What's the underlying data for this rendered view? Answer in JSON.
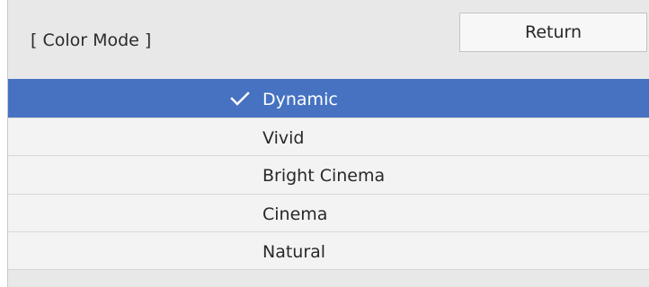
{
  "header": {
    "title": "[ Color Mode ]",
    "return_label": "Return"
  },
  "options": [
    {
      "label": "Dynamic",
      "selected": true
    },
    {
      "label": "Vivid",
      "selected": false
    },
    {
      "label": "Bright Cinema",
      "selected": false
    },
    {
      "label": "Cinema",
      "selected": false
    },
    {
      "label": "Natural",
      "selected": false
    }
  ],
  "icons": {
    "selected_marker": "check-icon"
  },
  "colors": {
    "selected_row": "#4672c1",
    "panel": "#e8e8e8",
    "row": "#f3f3f3",
    "text": "#282828"
  }
}
